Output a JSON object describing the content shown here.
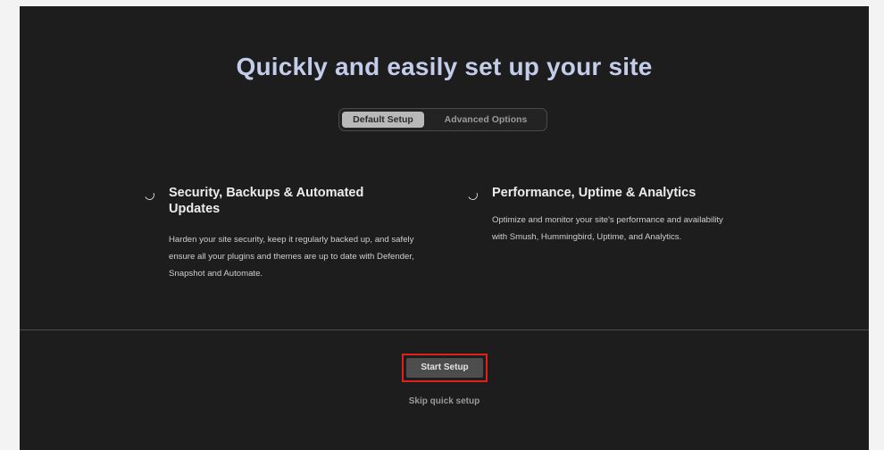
{
  "header": {
    "title": "Quickly and easily set up your site"
  },
  "toggle": {
    "default_label": "Default Setup",
    "advanced_label": "Advanced Options",
    "selected": "Default Setup"
  },
  "features": [
    {
      "title": "Security, Backups & Automated Updates",
      "description": "Harden your site security, keep it regularly backed up, and safely ensure all your plugins and themes are up to date with Defender, Snapshot and Automate.",
      "icon": "loading-spinner-icon"
    },
    {
      "title": "Performance, Uptime & Analytics",
      "description": "Optimize and monitor your site's performance and availability with Smush, Hummingbird, Uptime, and Analytics.",
      "icon": "loading-spinner-icon"
    }
  ],
  "footer": {
    "start_label": "Start Setup",
    "skip_label": "Skip quick setup"
  },
  "colors": {
    "panel_background": "#1d1d1d",
    "title": "#c3cce9",
    "highlight_border": "#e01f1f"
  }
}
